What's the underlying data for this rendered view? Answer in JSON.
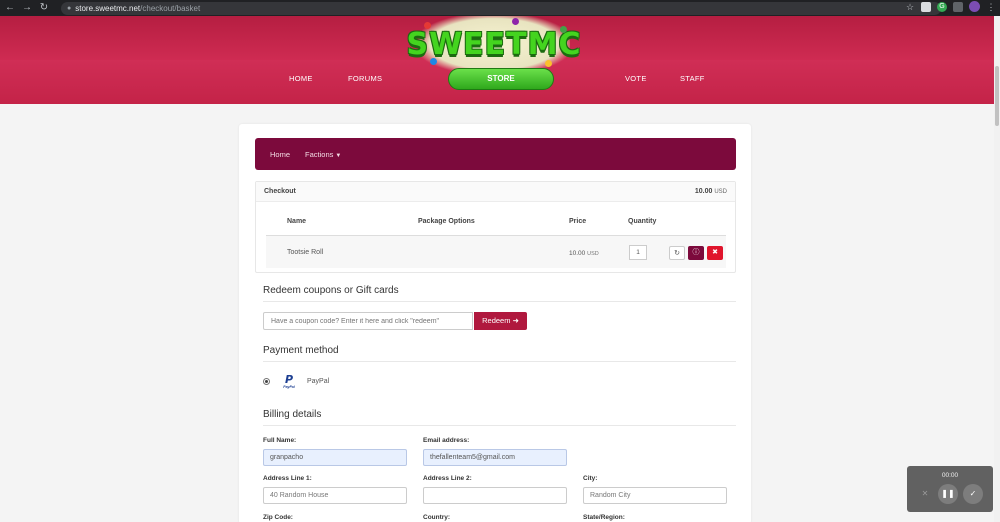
{
  "browser": {
    "url_host": "store.sweetmc.net",
    "url_path": "/checkout/basket"
  },
  "site": {
    "logo_text": "SWEETMC",
    "nav": {
      "home": "HOME",
      "forums": "FORUMS",
      "store": "STORE",
      "vote": "VOTE",
      "staff": "STAFF"
    }
  },
  "subnav": {
    "home": "Home",
    "factions": "Factions"
  },
  "checkout": {
    "title": "Checkout",
    "total_amount": "10.00",
    "total_currency": "USD",
    "columns": {
      "name": "Name",
      "options": "Package Options",
      "price": "Price",
      "quantity": "Quantity"
    },
    "item": {
      "name": "Tootsie Roll",
      "price": "10.00",
      "currency": "USD",
      "quantity": "1"
    }
  },
  "coupon": {
    "title": "Redeem coupons or Gift cards",
    "placeholder": "Have a coupon code? Enter it here and click \"redeem\"",
    "button": "Redeem"
  },
  "payment": {
    "title": "Payment method",
    "option": "PayPal",
    "logo_word": "PayPal"
  },
  "billing": {
    "title": "Billing details",
    "full_name_label": "Full Name:",
    "full_name_value": "granpacho",
    "email_label": "Email address:",
    "email_value": "thefallenteam5@gmail.com",
    "address1_label": "Address Line 1:",
    "address1_placeholder": "40 Random House",
    "address2_label": "Address Line 2:",
    "city_label": "City:",
    "city_placeholder": "Random City",
    "zip_label": "Zip Code:",
    "country_label": "Country:",
    "state_label": "State/Region:"
  },
  "recorder": {
    "time": "00:00"
  },
  "colors": {
    "header": "#c6244a",
    "subnav": "#7c0a3c",
    "accent": "#b0183e",
    "store_pill": "#3cb626"
  }
}
